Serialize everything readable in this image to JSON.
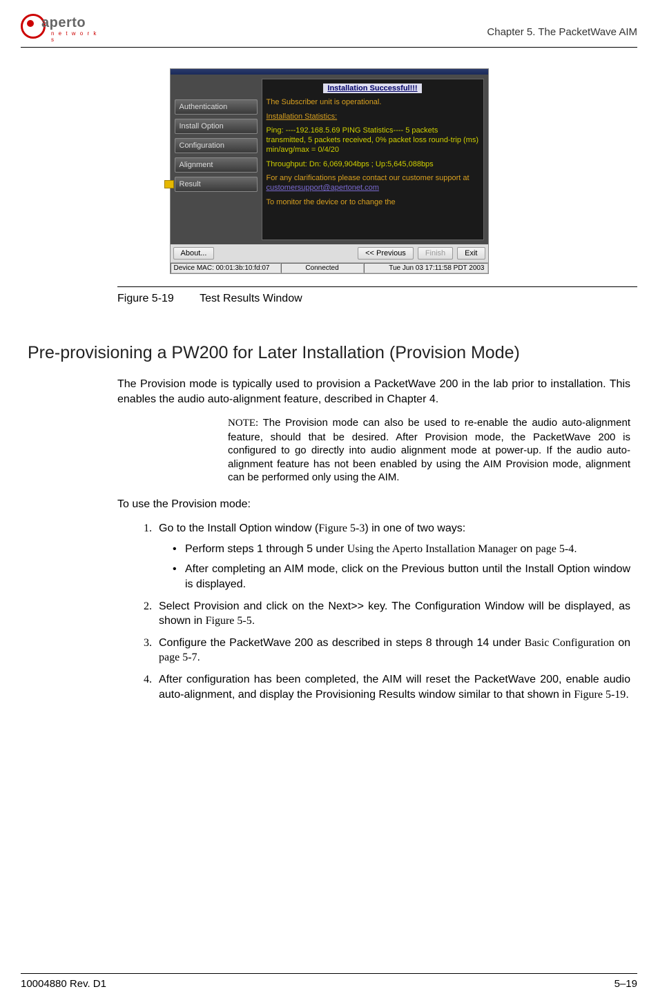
{
  "header": {
    "logo_text": "aperto",
    "logo_sub": "n e t w o r k s",
    "chapter": "Chapter 5.  The PacketWave AIM"
  },
  "screenshot": {
    "tabs": [
      "Authentication",
      "Install Option",
      "Configuration",
      "Alignment",
      "Result"
    ],
    "banner": "Installation Successful!!!",
    "line1": "The Subscriber unit is operational.",
    "line2": "Installation Statistics:",
    "ping": "Ping: ----192.168.5.69 PING Statistics---- 5 packets transmitted, 5 packets received, 0% packet loss round-trip (ms) min/avg/max = 0/4/20",
    "throughput": "Throughput: Dn: 6,069,904bps ; Up:5,645,088bps",
    "support1": "For any clarifications please contact our customer support at",
    "support_link": "customersupport@apertonet.com",
    "monitor": "To monitor the device or to change the",
    "btn_about": "About...",
    "btn_prev": "<< Previous",
    "btn_finish": "Finish",
    "btn_exit": "Exit",
    "status_mac": "Device MAC: 00:01:3b:10:fd:07",
    "status_conn": "Connected",
    "status_time": "Tue Jun 03 17:11:58 PDT 2003"
  },
  "figure": {
    "num": "Figure 5-19",
    "title": "Test Results Window"
  },
  "section_title": "Pre-provisioning a PW200 for Later Installation (Provision Mode)",
  "para1": "The Provision mode is typically used to provision a PacketWave 200 in the lab prior to installation. This enables the audio auto-alignment feature, described in Chapter 4.",
  "note_label": "NOTE:",
  "note_body": "The Provision mode can also be used to re-enable the audio auto-alignment feature, should that be desired. After Provision mode, the PacketWave 200 is configured to go directly into audio alignment mode at power-up. If the audio auto-alignment feature has not been enabled by using the AIM Provision mode, alignment can be performed only using the AIM.",
  "para2": "To use the Provision mode:",
  "steps": {
    "s1_a": "Go to the Install Option window (",
    "s1_ref": "Figure 5-3",
    "s1_b": ") in one of two ways:",
    "s1_bullet1_a": "Perform steps 1 through 5 under ",
    "s1_bullet1_ref": "Using the Aperto Installation Manager",
    "s1_bullet1_b": " on ",
    "s1_bullet1_page": "page 5-4",
    "s1_bullet1_c": ".",
    "s1_bullet2": "After completing an AIM mode, click on the Previous button until the Install Option window is displayed.",
    "s2_a": "Select Provision and click on the Next>> key. The Configuration Window will be displayed, as shown in ",
    "s2_ref": "Figure 5-5",
    "s2_b": ".",
    "s3_a": "Configure the PacketWave 200 as described in steps 8 through 14 under ",
    "s3_ref": "Basic Configuration",
    "s3_b": " on ",
    "s3_page": "page 5-7",
    "s3_c": ".",
    "s4_a": "After configuration has been completed, the AIM will reset the PacketWave 200, enable audio auto-alignment, and display the Provisioning Results window similar to that shown in ",
    "s4_ref": "Figure 5-19",
    "s4_b": "."
  },
  "footer": {
    "left": "10004880 Rev. D1",
    "right": "5–19"
  }
}
